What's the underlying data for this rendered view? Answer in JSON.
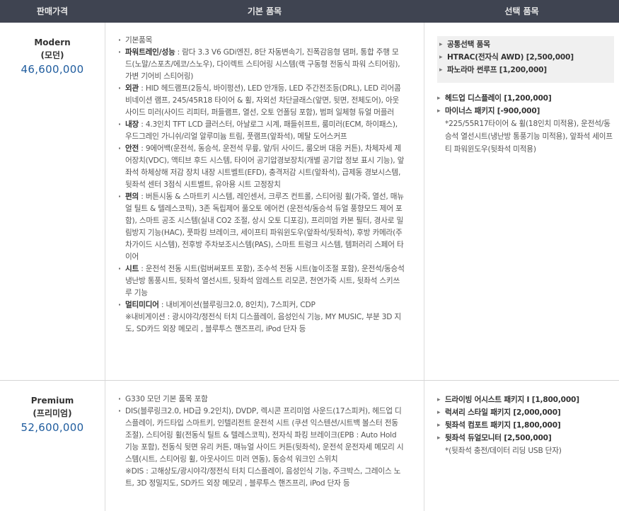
{
  "header": {
    "col1": "판매가격",
    "col2": "기본 품목",
    "col3": "선택 품목"
  },
  "trims": [
    {
      "name": "Modern",
      "korean": "(모던)",
      "price": "46,600,000",
      "basic": [
        {
          "label": "",
          "text": "기본품목"
        },
        {
          "label": "파워트레인/성능",
          "text": "람다 3.3 V6 GDi엔진, 8단 자동변속기, 진폭감응형 댐퍼, 통합 주행 모드(노말/스포츠/에코/스노우), 다이렉트 스티어링 시스템(랙 구동형 전동식 파워 스티어링), 가변 기어비 스티어링)"
        },
        {
          "label": "외관",
          "text": "HID 헤드램프(2등식, 바이펑션), LED 안개등, LED 주간전조등(DRL), LED 리어콤비네이션 램프, 245/45R18 타이어 & 휠, 자외선 차단글래스(앞면, 뒷면, 전체도어), 아웃사이드 미러(사이드 리피터, 퍼들램프, 열선, 오토 언폴딩 포함), 범퍼 일체형 듀얼 머플러"
        },
        {
          "label": "내장",
          "text": "4.3인치 TFT LCD 클러스터, 아날로그 시계, 패들쉬프트, 룸미러(ECM, 하이패스), 우드그레인 가니쉬/리얼 알루미늄 트림, 풋램프(앞좌석), 메탈 도어스커프"
        },
        {
          "label": "안전",
          "text": "9에어백(운전석, 동승석, 운전석 무릎, 앞/뒤 사이드, 룸오버 대응 커튼), 차체자세 제어장치(VDC), 액티브 후드 시스템, 타이어 공기압경보장치(개별 공기압 정보 표시 기능), 앞좌석 하체상해 저감 장치 내장 시트벨트(EFD), 충격저감 시트(앞좌석), 급제동 경보시스템, 뒷좌석 센터 3점식 시트벨트, 유아용 시트 고정장치"
        },
        {
          "label": "편의",
          "text": "버튼시동 & 스마트키 시스템, 레인센서, 크루즈 컨트롤, 스티어링 휠(가죽, 열선, 매뉴얼 틸트 & 텔레스코픽), 3존 독립제어 풀오토 에어컨 (운전석/동승석 듀얼 풍향모드 제어 포함), 스마트 공조 시스템(실내 CO2 조절, 상시 오토 디포깅), 프리미엄 카본 필터, 경사로 밀림방지 기능(HAC), 풋파킹 브레이크, 세이프티 파워윈도우(앞좌석/뒷좌석), 후방 카메라(주차가이드 시스템), 전후방 주차보조시스템(PAS), 스마트 트렁크 시스템, 템퍼러리 스페어 타이어"
        },
        {
          "label": "시트",
          "text": "운전석 전동 시트(럼버써포트 포함), 조수석 전동 시트(높이조절 포함), 운전석/동승석 냉난방 통풍시트, 뒷좌석 열선시트, 뒷좌석 암레스트 리모콘, 천연가죽 시트, 뒷좌석 스키쓰루 기능"
        },
        {
          "label": "멀티미디어",
          "text": "내비게이션(블루링크2.0, 8인치), 7스피커, CDP",
          "note": "※내비게이션 : 광시야각/정전식 터치 디스플레이, 음성인식 기능, MY MUSIC, 부분 3D 지도, SD카드 외장 메모리 , 블루투스 핸즈프리, iPod 단자 등"
        }
      ],
      "common_title": "공통선택 품목",
      "common": [
        "HTRAC(전자식 AWD) [2,500,000]",
        "파노라마 썬루프 [1,200,000]"
      ],
      "options": [
        {
          "text": "헤드업 디스플레이 [1,200,000]"
        },
        {
          "text": "마이너스 패키지 [-900,000]",
          "note": "*225/55R17타이어 & 휠(18인치 미적용), 운전석/동승석 열선시트(냉난방 통풍기능 미적용), 앞좌석 세이프티 파워윈도우(뒷좌석 미적용)"
        }
      ]
    },
    {
      "name": "Premium",
      "korean": "(프리미엄)",
      "price": "52,600,000",
      "basic": [
        {
          "label": "",
          "text": "G330 모던 기본 품목 포함"
        },
        {
          "label": "",
          "text": "DIS(블루링크2.0, HD급 9.2인치), DVDP, 렉시콘 프리미엄 사운드(17스피커), 헤드업 디스플레이, 카드타입 스마트키, 인텔리전트 운전석 시트 (쿠션 익스텐션/시트백 볼스터 전동 조절), 스티어링 휠(전동식 틸트 & 텔레스코픽), 전자식 파킹 브레이크(EPB : Auto Hold 기능 포함), 전동식 뒷면 유리 커튼, 매뉴얼 사이드 커튼(뒷좌석), 운전석 운전자세 메모리 시스템(시트, 스티어링 휠, 아웃사이드 미러 연동), 동승석 워크인 스위치",
          "note": "※DIS : 고해상도/광시야각/정전식 터치 디스플레이, 음성인식 기능, 주크박스, 그레이스 노트, 3D 정밀지도, SD카드 외장 메모리 , 블루투스 핸즈프리, iPod 단자 등"
        }
      ],
      "options": [
        {
          "text": "드라이빙 어시스트 패키지 I [1,800,000]"
        },
        {
          "text": "럭셔리 스타일 패키지 [2,000,000]"
        },
        {
          "text": "뒷좌석 컴포트 패키지 [1,800,000]"
        },
        {
          "text": "뒷좌석 듀얼모니터 [2,500,000]",
          "note": "*(뒷좌석 충전/데이터 리딩 USB 단자)"
        }
      ]
    }
  ],
  "colors": {
    "header_bg": "#3f4451",
    "price": "#1f5c9e",
    "common_bg": "#f0f0f0"
  }
}
